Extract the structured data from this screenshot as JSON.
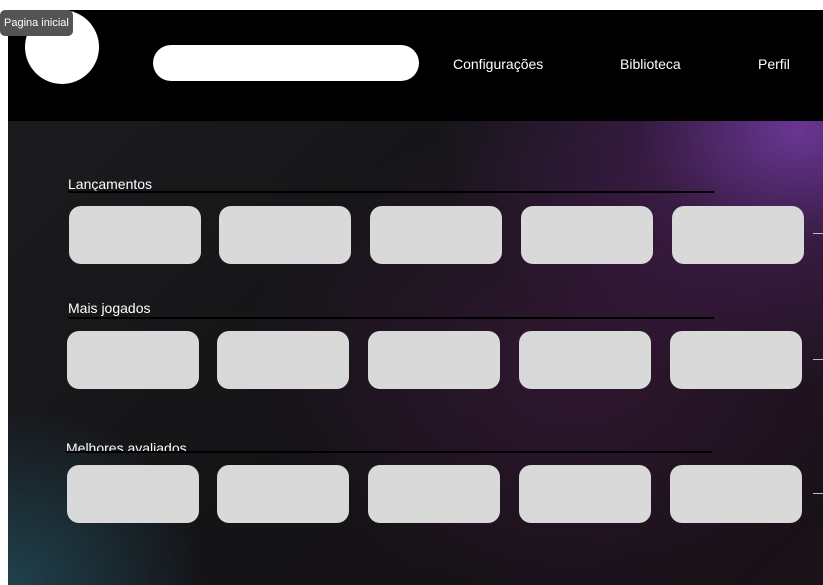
{
  "header": {
    "home_tooltip": "Pagina inicial",
    "search": {
      "value": "",
      "placeholder": ""
    },
    "nav": [
      {
        "label": "Configurações"
      },
      {
        "label": "Biblioteca"
      },
      {
        "label": "Perfil"
      }
    ]
  },
  "sections": [
    {
      "title": "Lançamentos",
      "card_count": 5
    },
    {
      "title": "Mais jogados",
      "card_count": 5
    },
    {
      "title": "Melhores avaliados",
      "card_count": 5
    }
  ],
  "colors": {
    "header_bg": "#000000",
    "card_bg": "#d9d9d9",
    "accent_purple": "#7a3ca8",
    "accent_teal": "#23505f"
  }
}
